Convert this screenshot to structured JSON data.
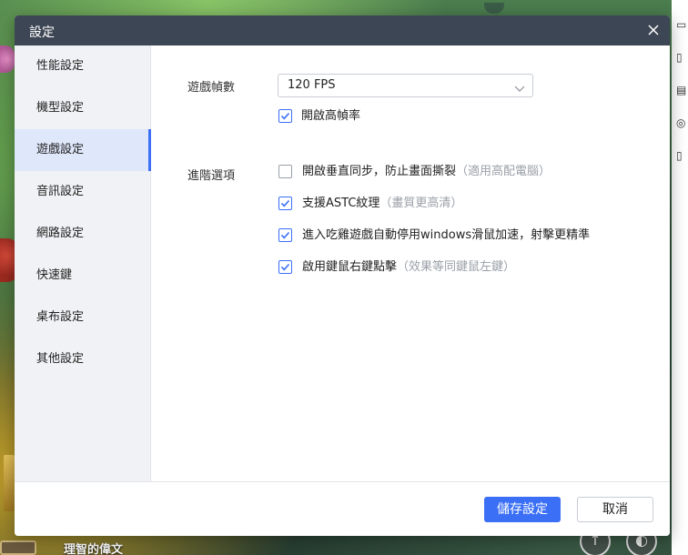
{
  "background": {
    "player_name": "理智的偉文"
  },
  "dialog": {
    "title": "設定",
    "sidebar": {
      "items": [
        {
          "label": "性能設定"
        },
        {
          "label": "機型設定"
        },
        {
          "label": "遊戲設定",
          "active": true
        },
        {
          "label": "音訊設定"
        },
        {
          "label": "網路設定"
        },
        {
          "label": "快速鍵"
        },
        {
          "label": "桌布設定"
        },
        {
          "label": "其他設定"
        }
      ]
    },
    "game_settings": {
      "frame_rate_label": "遊戲幀數",
      "frame_rate_value": "120 FPS",
      "high_fps": {
        "label": "開啟高幀率",
        "checked": true
      },
      "advanced_label": "進階選項",
      "options": [
        {
          "label": "開啟垂直同步，防止畫面撕裂",
          "hint": "（適用高配電腦）",
          "checked": false
        },
        {
          "label": "支援ASTC紋理",
          "hint": "（畫質更高清）",
          "checked": true
        },
        {
          "label": "進入吃雞遊戲自動停用windows滑鼠加速，射擊更精準",
          "hint": "",
          "checked": true
        },
        {
          "label": "啟用鍵鼠右鍵點擊",
          "hint": "（效果等同鍵鼠左鍵）",
          "checked": true
        }
      ]
    },
    "footer": {
      "save_label": "儲存設定",
      "cancel_label": "取消"
    }
  },
  "colors": {
    "header_bg": "#3d4654",
    "accent": "#3b6ff5",
    "sidebar_bg": "#f1f2f5",
    "active_item_bg": "#dfe7fb"
  }
}
